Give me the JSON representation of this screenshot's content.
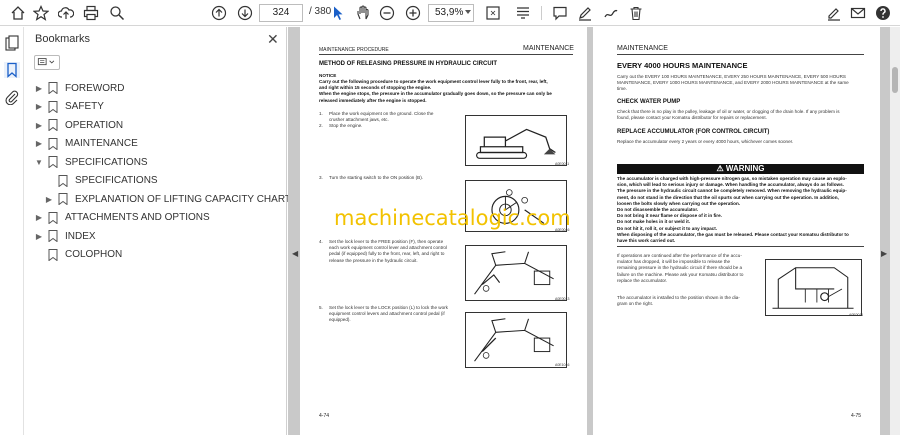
{
  "toolbar": {
    "current_page": "324",
    "total_pages": "/ 380",
    "zoom": "53,9%"
  },
  "bookmarks": {
    "title": "Bookmarks",
    "items": [
      {
        "label": "FOREWORD",
        "expandable": true
      },
      {
        "label": "SAFETY",
        "expandable": true
      },
      {
        "label": "OPERATION",
        "expandable": true
      },
      {
        "label": "MAINTENANCE",
        "expandable": true
      },
      {
        "label": "SPECIFICATIONS",
        "expandable": true,
        "expanded": true
      },
      {
        "label": "SPECIFICATIONS",
        "expandable": false,
        "child": true
      },
      {
        "label": "EXPLANATION OF LIFTING CAPACITY CHART",
        "expandable": true,
        "child": true
      },
      {
        "label": "ATTACHMENTS AND OPTIONS",
        "expandable": true
      },
      {
        "label": "INDEX",
        "expandable": true
      },
      {
        "label": "COLOPHON",
        "expandable": false
      }
    ]
  },
  "left_page": {
    "header_small": "MAINTENANCE PROCEDURE",
    "header_large": "MAINTENANCE",
    "title": "METHOD OF RELEASING PRESSURE IN HYDRAULIC CIRCUIT",
    "notice_label": "NOTICE",
    "notice_lines": [
      "Carry out the following procedure to operate the work equipment control lever fully to the front, rear, left,",
      "and right within 15 seconds of stopping the engine.",
      "When the engine stops, the pressure in the accumulator gradually goes down, so the pressure can only be",
      "released immediately after the engine is stopped."
    ],
    "steps": [
      {
        "n": "1.",
        "lines": [
          "Place the work equipment on the ground. Close the",
          "crusher attachment jaws, etc."
        ]
      },
      {
        "n": "2.",
        "lines": [
          "Stop the engine."
        ]
      },
      {
        "n": "3.",
        "lines": [
          "Turn the starting switch to the ON position (B)."
        ]
      },
      {
        "n": "4.",
        "lines": [
          "Set the lock lever to the FREE position (F), then operate",
          "each work equipment control lever and attachment control",
          "pedal (if equipped) fully to the front, rear, left, and right to",
          "release the pressure in the hydraulic circuit."
        ]
      },
      {
        "n": "5.",
        "lines": [
          "Set the lock lever to the LOCK position (L) to lock the work",
          "equipment control levers and attachment control pedal (if",
          "equipped)."
        ]
      }
    ],
    "fig_numbers": [
      "A0E0011",
      "A0E0046",
      "A0E0013",
      "A0E1046"
    ],
    "page_number": "4-74"
  },
  "right_page": {
    "header_large": "MAINTENANCE",
    "section_title": "EVERY 4000 HOURS MAINTENANCE",
    "intro_lines": [
      "Carry out the EVERY 100 HOURS MAINTENANCE, EVERY 250 HOURS MAINTENANCE, EVERY 500 HOURS",
      "MAINTENANCE, EVERY 1000 HOURS MAINTENANCE, and EVERY 2000 HOURS MAINTENANCE at the same",
      "time."
    ],
    "sub1": "CHECK WATER PUMP",
    "sub1_lines": [
      "Check that there is no play in the pulley, leakage of oil or water, or clogging of the drain hole. If any problem is",
      "found, please contact your Komatsu distributor for repairs or replacement."
    ],
    "sub2": "REPLACE ACCUMULATOR (FOR CONTROL CIRCUIT)",
    "sub2_lines": [
      "Replace the accumulator every 2 years or every 4000 hours, whichever comes sooner."
    ],
    "warning_label": "WARNING",
    "warning_lines": [
      "The accumulator is charged with high-pressure nitrogen gas, so mistaken operation may cause an explo-",
      "sion, which will lead to serious injury or damage. When handling the accumulator, always do as follows.",
      "The pressure in the hydraulic circuit cannot be completely removed. When removing the hydraulic equip-",
      "ment, do not stand in the direction that the oil spurts out when carrying out the operation. In addition,",
      "loosen the bolts slowly when carrying out the operation.",
      "Do not disassemble the accumulator.",
      "Do not bring it near flame or dispose of it in fire.",
      "Do not make holes in it or weld it.",
      "Do not hit it, roll it, or subject it to any impact.",
      "When disposing of the accumulator, the gas must be released. Please contact your Komatsu distributor to",
      "have this work carried out."
    ],
    "body_lines": [
      "If operations are continued after the performance of the accu-",
      "mulator has dropped, it will be impossible to release the",
      "remaining pressure in the hydraulic circuit if there should be a",
      "failure on the machine. Please ask your Komatsu distributor to",
      "replace the accumulator."
    ],
    "body2_lines": [
      "The accumulator is installed to the position shown in the dia-",
      "gram on the right."
    ],
    "fig_number": "A0E0011",
    "page_number": "4-75"
  },
  "watermark": "machinecatalogic.com"
}
